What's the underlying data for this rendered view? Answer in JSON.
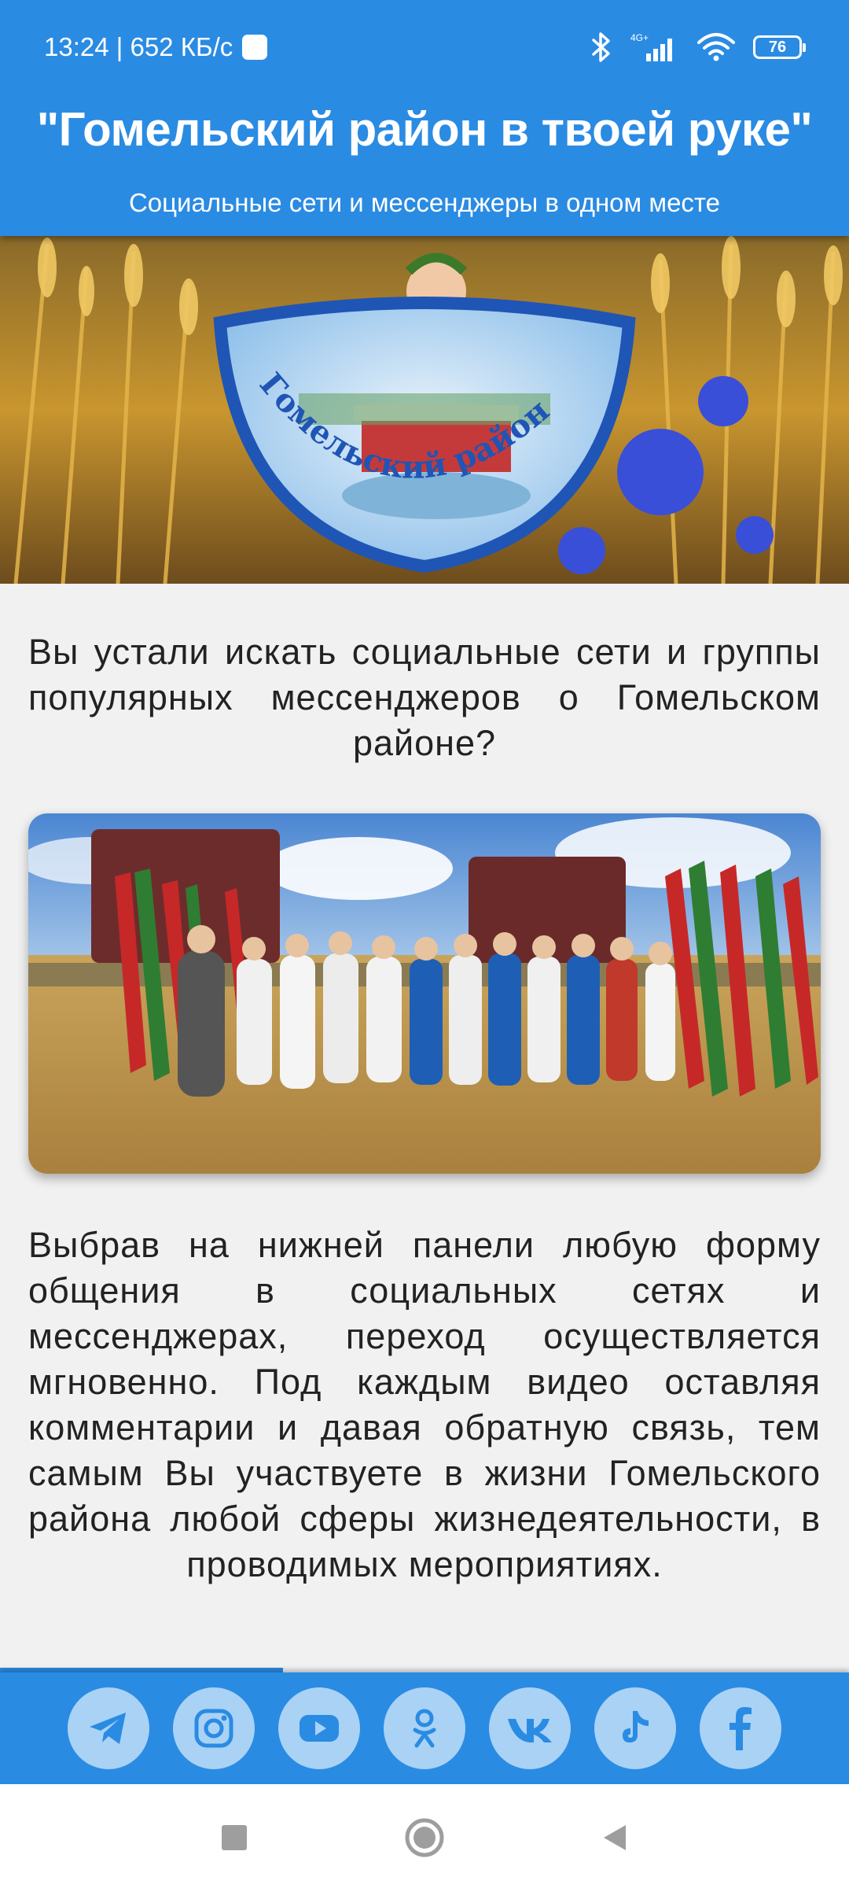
{
  "status_bar": {
    "time_speed": "13:24 | 652 КБ/с",
    "network": "4G+",
    "battery": "76"
  },
  "header": {
    "title": "\"Гомельский район в твоей руке\"",
    "subtitle": "Социальные сети и мессенджеры в одном месте"
  },
  "hero": {
    "skirt_text": "Гомельский район"
  },
  "content": {
    "intro": "Вы устали искать социальные сети и группы популярных мессенджеров о Гомельском районе?",
    "body": "Выбрав на нижней панели любую форму общения в социальных сетях и мессенджерах, переход осуществляется мгновенно. Под каждым видео оставляя комментарии и давая обратную связь, тем самым Вы участвуете в жизни Гомельского района любой сферы жизнедеятельности, в проводимых мероприятиях."
  },
  "scroll_progress": 0.333,
  "social": [
    {
      "name": "telegram-icon"
    },
    {
      "name": "instagram-icon"
    },
    {
      "name": "youtube-icon"
    },
    {
      "name": "odnoklassniki-icon"
    },
    {
      "name": "vk-icon"
    },
    {
      "name": "tiktok-icon"
    },
    {
      "name": "facebook-icon"
    }
  ],
  "colors": {
    "brand": "#2a8be3",
    "icon_bg": "#a9d2f5",
    "icon_fg": "#2a8be3"
  }
}
